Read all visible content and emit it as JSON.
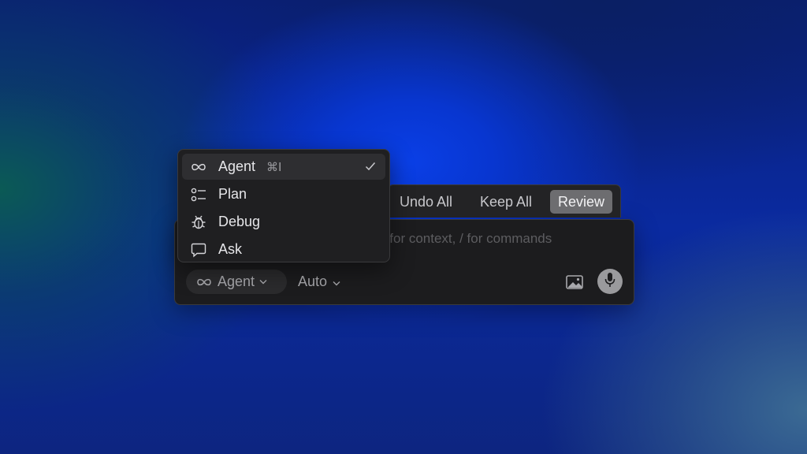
{
  "composer": {
    "placeholder": "Plan, search, build anything. @ for context, / for commands",
    "mode_label": "Agent",
    "model_label": "Auto",
    "icons": {
      "mode": "infinity-icon",
      "mode_chevron": "chevron-down-icon",
      "model_chevron": "chevron-down-icon",
      "image": "image-icon",
      "mic": "microphone-icon"
    }
  },
  "actionbar": {
    "undo_all": "Undo All",
    "keep_all": "Keep All",
    "review": "Review"
  },
  "menu": {
    "items": [
      {
        "label": "Agent",
        "icon": "infinity-icon",
        "shortcut": "⌘I",
        "selected": true
      },
      {
        "label": "Plan",
        "icon": "list-icon"
      },
      {
        "label": "Debug",
        "icon": "bug-icon"
      },
      {
        "label": "Ask",
        "icon": "chat-bubble-icon"
      }
    ],
    "check_icon": "checkmark-icon"
  },
  "colors": {
    "panel": "#1c1c1e",
    "menu": "#1f1f21",
    "review_button": "#6d6d70",
    "background_blue": "#0a3fe6"
  }
}
